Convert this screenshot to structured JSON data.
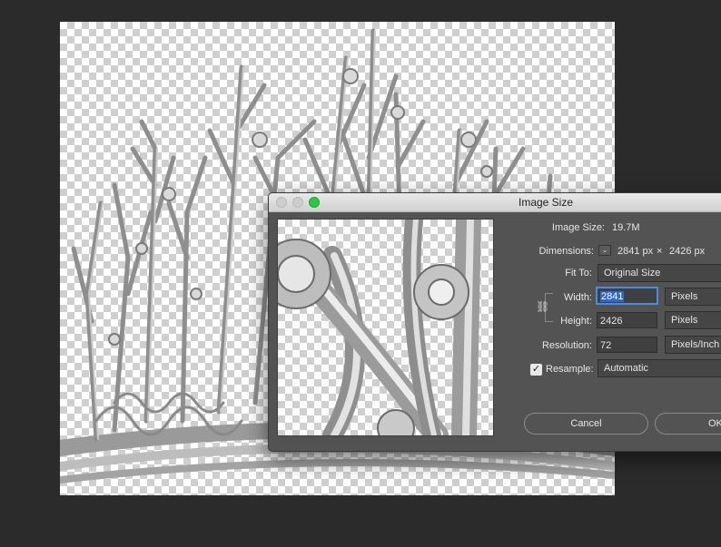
{
  "dialog": {
    "title": "Image Size",
    "image_size": {
      "label": "Image Size:",
      "value": "19.7M"
    },
    "dimensions": {
      "label": "Dimensions:",
      "width": "2841 px",
      "separator": "×",
      "height": "2426 px"
    },
    "fit_to": {
      "label": "Fit To:",
      "value": "Original Size"
    },
    "width": {
      "label": "Width:",
      "value": "2841",
      "unit": "Pixels"
    },
    "height": {
      "label": "Height:",
      "value": "2426",
      "unit": "Pixels"
    },
    "resolution": {
      "label": "Resolution:",
      "value": "72",
      "unit": "Pixels/Inch"
    },
    "resample": {
      "label": "Resample:",
      "checked": true,
      "value": "Automatic"
    },
    "cancel_label": "Cancel",
    "ok_label": "OK"
  },
  "icons": [
    "close-window-icon",
    "minimize-window-icon",
    "zoom-window-icon",
    "chevron-down-icon",
    "chain-link-icon",
    "checkmark-icon"
  ],
  "colors": {
    "dialog_bg": "#535353",
    "zoom_button": "#2bc840",
    "selection": "#2f6ac8"
  }
}
